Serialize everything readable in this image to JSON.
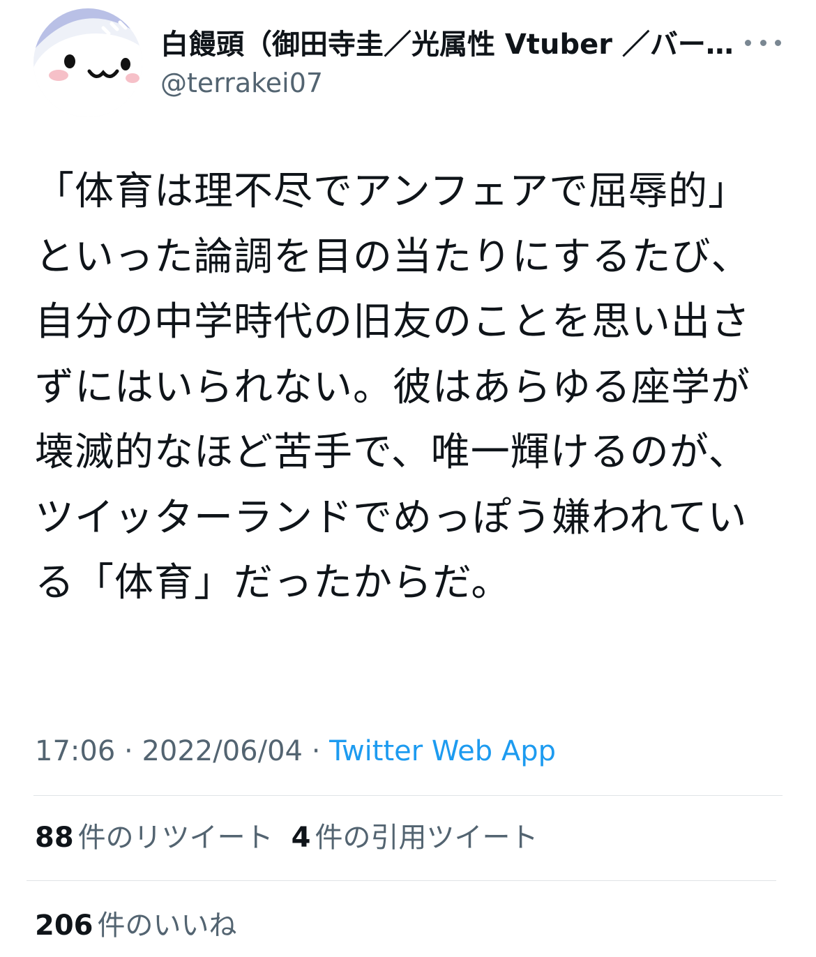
{
  "author": {
    "display_name": "白饅頭（御田寺圭／光属性 Vtuber ／バー…",
    "handle": "@terrakei07",
    "avatar_icon": "manju-mascot-avatar"
  },
  "more_icon": "more-dots-icon",
  "tweet": {
    "text": "「体育は理不尽でアンフェアで屈辱的」といった論調を目の当たりにするたび、自分の中学時代の旧友のことを思い出さずにはいられない。彼はあらゆる座学が壊滅的なほど苦手で、唯一輝けるのが、ツイッターランドでめっぽう嫌われている「体育」だったからだ。"
  },
  "meta": {
    "time": "17:06",
    "sep1": " · ",
    "date": "2022/06/04",
    "sep2": " · ",
    "source": "Twitter Web App"
  },
  "stats": {
    "retweets": {
      "count": "88",
      "label": "件のリツイート"
    },
    "quotes": {
      "count": "4",
      "label": "件の引用ツイート"
    },
    "likes": {
      "count": "206",
      "label": "件のいいね"
    }
  },
  "colors": {
    "text": "#0f1419",
    "secondary": "#536471",
    "link": "#1d9bf0",
    "divider": "#dfe3e6"
  }
}
